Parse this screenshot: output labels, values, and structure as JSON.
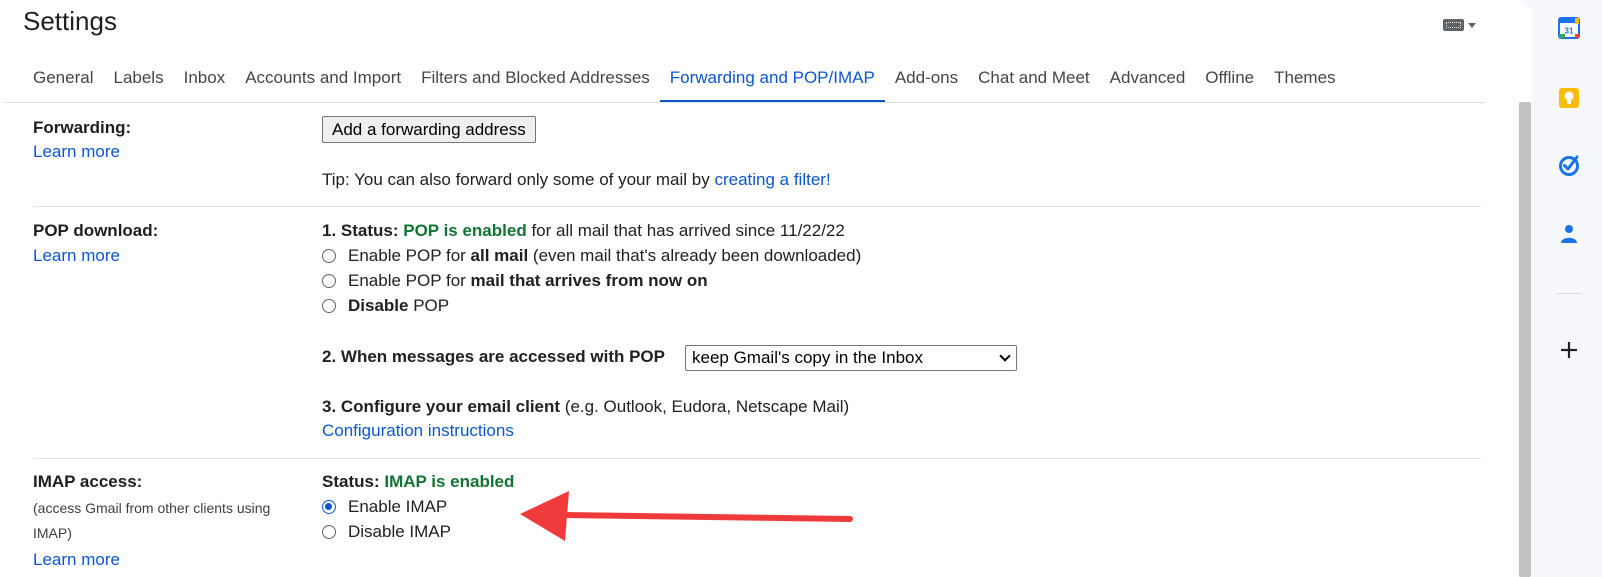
{
  "header": {
    "title": "Settings"
  },
  "tabs": [
    {
      "label": "General"
    },
    {
      "label": "Labels"
    },
    {
      "label": "Inbox"
    },
    {
      "label": "Accounts and Import"
    },
    {
      "label": "Filters and Blocked Addresses"
    },
    {
      "label": "Forwarding and POP/IMAP",
      "active": true
    },
    {
      "label": "Add-ons"
    },
    {
      "label": "Chat and Meet"
    },
    {
      "label": "Advanced"
    },
    {
      "label": "Offline"
    },
    {
      "label": "Themes"
    }
  ],
  "forwarding": {
    "label": "Forwarding:",
    "learn_more": "Learn more",
    "button": "Add a forwarding address",
    "tip_prefix": "Tip: You can also forward only some of your mail by ",
    "tip_link": "creating a filter!"
  },
  "pop": {
    "label": "POP download:",
    "learn_more": "Learn more",
    "status_prefix": "1. Status: ",
    "status_value": "POP is enabled",
    "status_suffix": " for all mail that has arrived since 11/22/22",
    "option1_pre": "Enable POP for ",
    "option1_bold": "all mail",
    "option1_post": " (even mail that's already been downloaded)",
    "option2_pre": "Enable POP for ",
    "option2_bold": "mail that arrives from now on",
    "option3_bold": "Disable",
    "option3_post": " POP",
    "when_label": "2. When messages are accessed with POP",
    "when_value": "keep Gmail's copy in the Inbox",
    "configure_bold": "3. Configure your email client",
    "configure_post": " (e.g. Outlook, Eudora, Netscape Mail)",
    "config_link": "Configuration instructions"
  },
  "imap": {
    "label": "IMAP access:",
    "desc_line1": "(access Gmail from other clients using",
    "desc_line2": "IMAP)",
    "learn_more": "Learn more",
    "status_prefix": "Status: ",
    "status_value": "IMAP is enabled",
    "enable": "Enable IMAP",
    "disable": "Disable IMAP",
    "selected": "enable"
  },
  "side_panel": {
    "calendar_day": "31",
    "icons": [
      "calendar-icon",
      "keep-icon",
      "tasks-icon",
      "contacts-icon",
      "add-icon"
    ]
  },
  "colors": {
    "accent": "#0b57d0",
    "status_green": "#137333",
    "arrow_red": "#ef3b3b"
  }
}
